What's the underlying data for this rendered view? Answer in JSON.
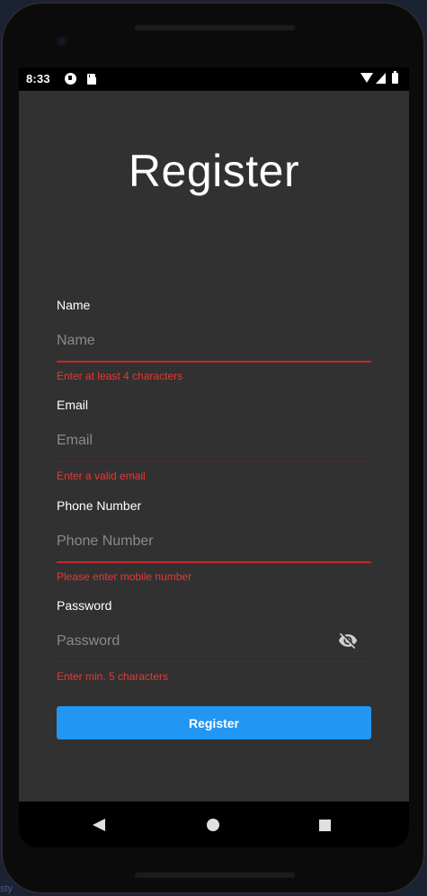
{
  "status_bar": {
    "time": "8:33"
  },
  "page": {
    "title": "Register"
  },
  "form": {
    "fields": [
      {
        "label": "Name",
        "placeholder": "Name",
        "value": "",
        "error": "Enter at least 4 characters"
      },
      {
        "label": "Email",
        "placeholder": "Email",
        "value": "",
        "error": "Enter a valid email"
      },
      {
        "label": "Phone Number",
        "placeholder": "Phone Number",
        "value": "",
        "error": "Please enter mobile number"
      },
      {
        "label": "Password",
        "placeholder": "Password",
        "value": "",
        "error": "Enter min. 5 characters"
      }
    ],
    "submit_label": "Register"
  },
  "icons": {
    "status": [
      "notification-app-icon",
      "sd-card-icon",
      "wifi-icon",
      "cell-signal-icon",
      "battery-icon"
    ],
    "password_toggle": "eye-off-icon",
    "navigation": [
      "back-icon",
      "home-icon",
      "recents-icon"
    ]
  },
  "colors": {
    "background": "#313131",
    "error": "#e53935",
    "accent": "#2196f3",
    "text": "#ffffff",
    "placeholder": "#8a8a8a"
  },
  "corner_text": "sty"
}
